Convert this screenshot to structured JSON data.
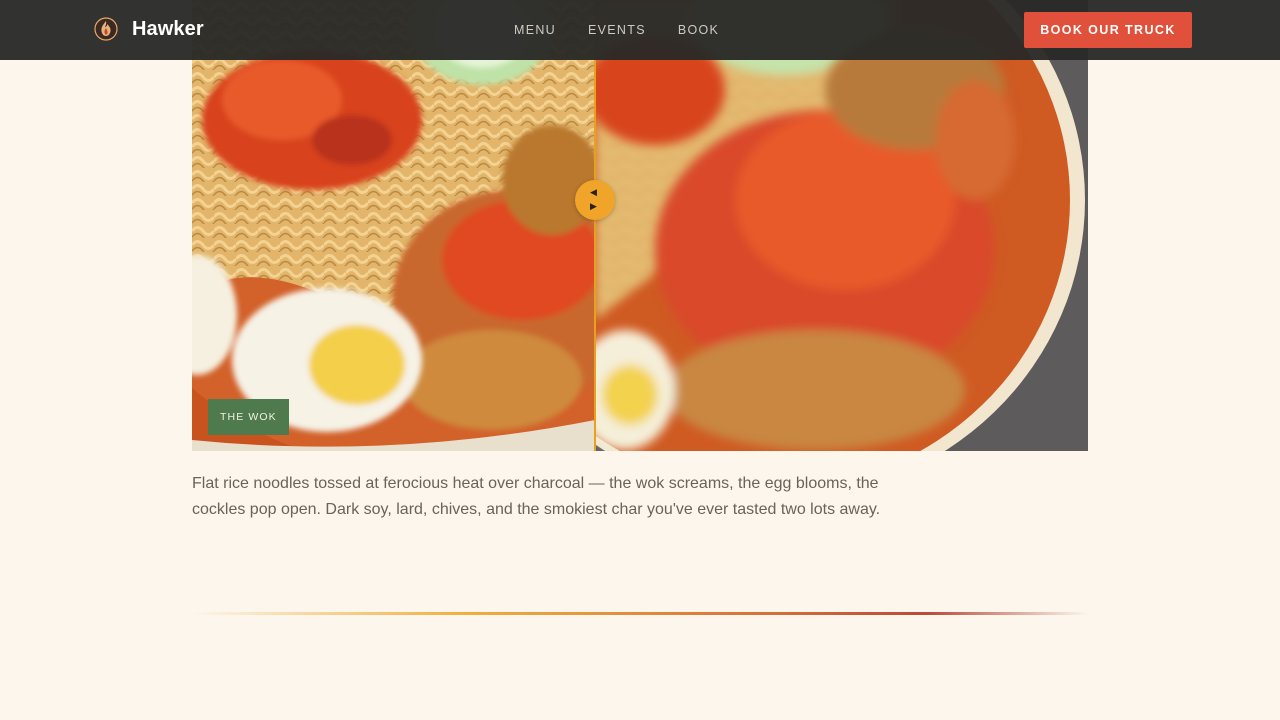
{
  "header": {
    "brand_name": "Hawker",
    "brand_logo_icon": "flame-logo-icon",
    "nav": [
      {
        "label": "MENU"
      },
      {
        "label": "EVENTS"
      },
      {
        "label": "BOOK"
      }
    ],
    "cta_label": "BOOK OUR TRUCK"
  },
  "compare": {
    "tag_label": "THE WOK",
    "handle_icons": [
      "arrow-left-icon",
      "arrow-right-icon"
    ]
  },
  "description": "Flat rice noodles tossed at ferocious heat over charcoal — the wok screams, the egg blooms, the cockles pop open. Dark soy, lard, chives, and the smokiest char you've ever tasted two lots away.",
  "colors": {
    "background": "#fcf6ec",
    "header_bg": "#2a2a28",
    "accent": "#e0503a",
    "handle": "#f0a52a",
    "tag_bg": "#4f7a4e",
    "body_text": "#6b625a"
  }
}
